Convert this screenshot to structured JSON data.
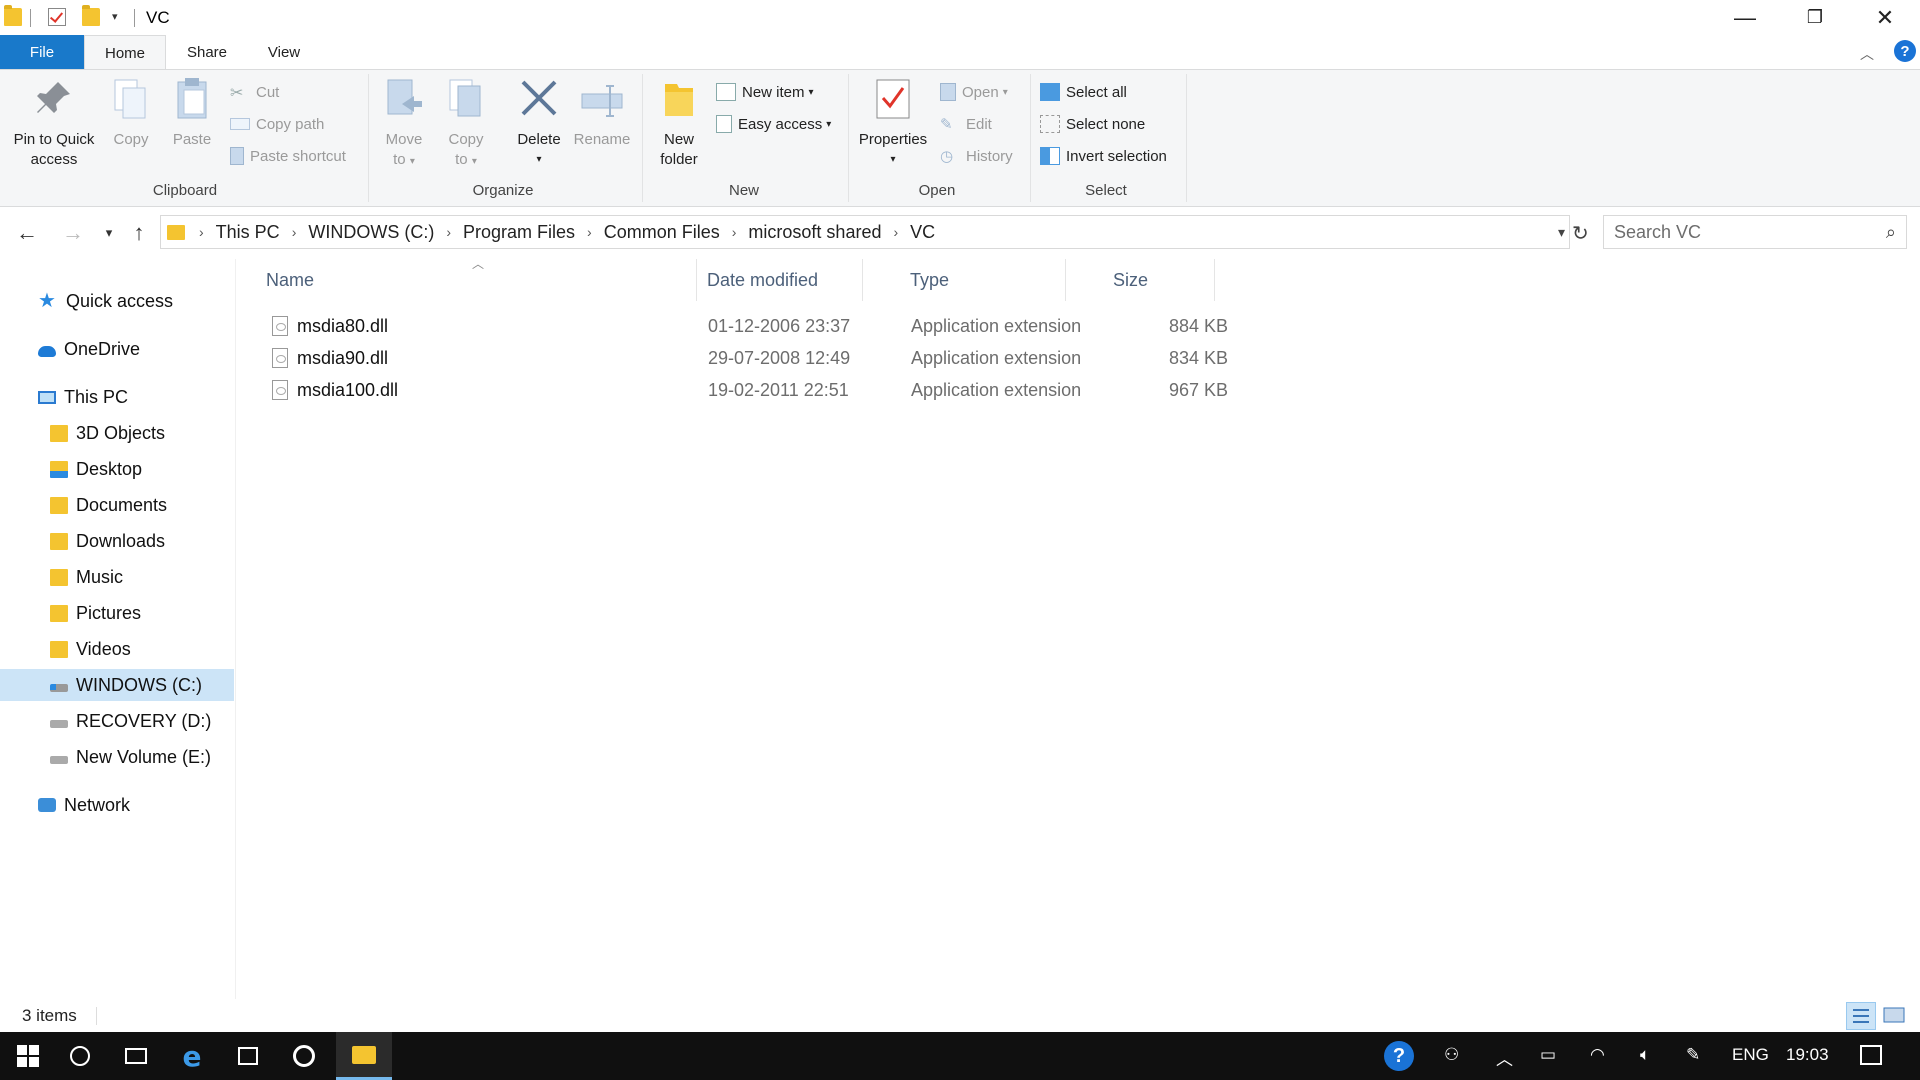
{
  "window": {
    "title": "VC",
    "minimize_glyph": "—",
    "restore_glyph": "❐",
    "close_glyph": "✕"
  },
  "ribbon_tabs": {
    "file": "File",
    "home": "Home",
    "share": "Share",
    "view": "View"
  },
  "ribbon": {
    "clipboard": {
      "pin_label_1": "Pin to Quick",
      "pin_label_2": "access",
      "copy": "Copy",
      "paste": "Paste",
      "cut": "Cut",
      "copy_path": "Copy path",
      "paste_shortcut": "Paste shortcut",
      "group": "Clipboard"
    },
    "organize": {
      "move_1": "Move",
      "move_2": "to",
      "copy_1": "Copy",
      "copy_2": "to",
      "delete": "Delete",
      "rename": "Rename",
      "group": "Organize"
    },
    "new": {
      "new_folder_1": "New",
      "new_folder_2": "folder",
      "new_item": "New item",
      "easy_access": "Easy access",
      "group": "New"
    },
    "open": {
      "properties": "Properties",
      "open": "Open",
      "edit": "Edit",
      "history": "History",
      "group": "Open"
    },
    "select": {
      "select_all": "Select all",
      "select_none": "Select none",
      "invert_selection": "Invert selection",
      "group": "Select"
    }
  },
  "address": {
    "crumbs": [
      "This PC",
      "WINDOWS (C:)",
      "Program Files",
      "Common Files",
      "microsoft shared",
      "VC"
    ],
    "search_placeholder": "Search VC"
  },
  "nav_pane": {
    "quick_access": "Quick access",
    "onedrive": "OneDrive",
    "this_pc": "This PC",
    "objects_3d": "3D Objects",
    "desktop": "Desktop",
    "documents": "Documents",
    "downloads": "Downloads",
    "music": "Music",
    "pictures": "Pictures",
    "videos": "Videos",
    "drive_c": "WINDOWS (C:)",
    "drive_d": "RECOVERY (D:)",
    "drive_e": "New Volume (E:)",
    "network": "Network"
  },
  "columns": {
    "name": "Name",
    "date": "Date modified",
    "type": "Type",
    "size": "Size"
  },
  "files": [
    {
      "name": "msdia80.dll",
      "date": "01-12-2006 23:37",
      "type": "Application extension",
      "size": "884 KB"
    },
    {
      "name": "msdia90.dll",
      "date": "29-07-2008 12:49",
      "type": "Application extension",
      "size": "834 KB"
    },
    {
      "name": "msdia100.dll",
      "date": "19-02-2011 22:51",
      "type": "Application extension",
      "size": "967 KB"
    }
  ],
  "status": {
    "count": "3 items"
  },
  "taskbar": {
    "language": "ENG",
    "time": "19:03"
  },
  "colors": {
    "accent": "#1979ca",
    "selection": "#cce4f7",
    "taskbar": "#101010"
  }
}
